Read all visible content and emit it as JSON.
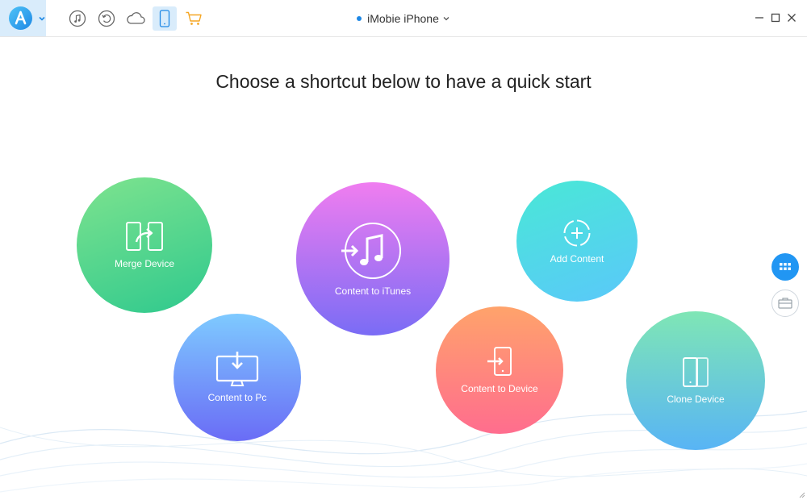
{
  "titlebar": {
    "device_name": "iMobie iPhone",
    "nav_icons": [
      "music-note-icon",
      "restore-icon",
      "cloud-icon",
      "phone-icon",
      "cart-icon"
    ],
    "active_nav": "phone-icon",
    "accent_color": "#1e88e5",
    "cart_color": "#f5a623"
  },
  "main": {
    "headline": "Choose a shortcut below to have a quick start",
    "shortcuts": [
      {
        "label": "Merge Device",
        "icon": "merge-device-icon",
        "colors": [
          "#7ee38e",
          "#2fc98e"
        ]
      },
      {
        "label": "Content to iTunes",
        "icon": "itunes-icon",
        "colors": [
          "#f07df0",
          "#7a6cf5"
        ]
      },
      {
        "label": "Add Content",
        "icon": "add-content-icon",
        "colors": [
          "#49e8d6",
          "#5ac8fa"
        ]
      },
      {
        "label": "Content to Pc",
        "icon": "content-to-pc-icon",
        "colors": [
          "#7ecaff",
          "#6a6cf6"
        ]
      },
      {
        "label": "Content to Device",
        "icon": "content-to-device-icon",
        "colors": [
          "#ffa36b",
          "#ff6d8e"
        ]
      },
      {
        "label": "Clone Device",
        "icon": "clone-device-icon",
        "colors": [
          "#7fe6b5",
          "#58b4f5"
        ]
      }
    ]
  },
  "side_buttons": [
    "grid-view-icon",
    "toolbox-icon"
  ]
}
